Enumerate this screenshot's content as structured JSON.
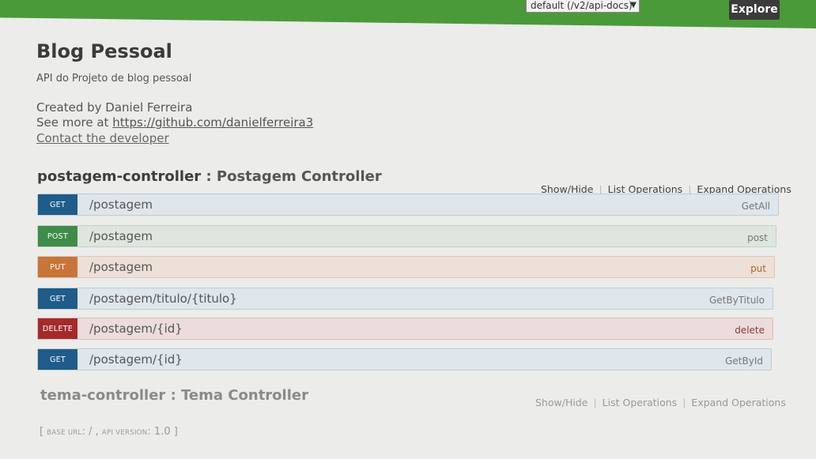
{
  "header": {
    "api_selector": "default (/v2/api-docs)",
    "explore_label": "Explore"
  },
  "info": {
    "title": "Blog Pessoal",
    "description": "API do Projeto de blog pessoal",
    "created_by": "Created by Daniel Ferreira",
    "see_more_prefix": "See more at ",
    "see_more_link": "https://github.com/danielferreira3",
    "contact": "Contact the developer"
  },
  "resources": [
    {
      "name": "postagem-controller",
      "separator": " : ",
      "description": "Postagem Controller",
      "show_hide": "Show/Hide",
      "list_ops": "List Operations",
      "expand_ops": "Expand Operations",
      "operations": [
        {
          "method": "GET",
          "path": "/postagem",
          "name": "GetAll"
        },
        {
          "method": "POST",
          "path": "/postagem",
          "name": "post"
        },
        {
          "method": "PUT",
          "path": "/postagem",
          "name": "put"
        },
        {
          "method": "GET",
          "path": "/postagem/titulo/{titulo}",
          "name": "GetByTitulo"
        },
        {
          "method": "DELETE",
          "path": "/postagem/{id}",
          "name": "delete"
        },
        {
          "method": "GET",
          "path": "/postagem/{id}",
          "name": "GetById"
        }
      ]
    },
    {
      "name": "tema-controller",
      "separator": " : ",
      "description": "Tema Controller",
      "show_hide": "Show/Hide",
      "list_ops": "List Operations",
      "expand_ops": "Expand Operations"
    }
  ],
  "footer": {
    "open": "[ ",
    "base_url_label": "BASE URL",
    "base_url_value": ": / , ",
    "api_version_label": "API VERSION",
    "api_version_value": ": 1.0 ]"
  },
  "colors": {
    "topbar": "#4a9a3a",
    "get": "#1f5c8a",
    "post": "#3f8c4a",
    "put": "#c9753a",
    "delete": "#a52a2a"
  }
}
